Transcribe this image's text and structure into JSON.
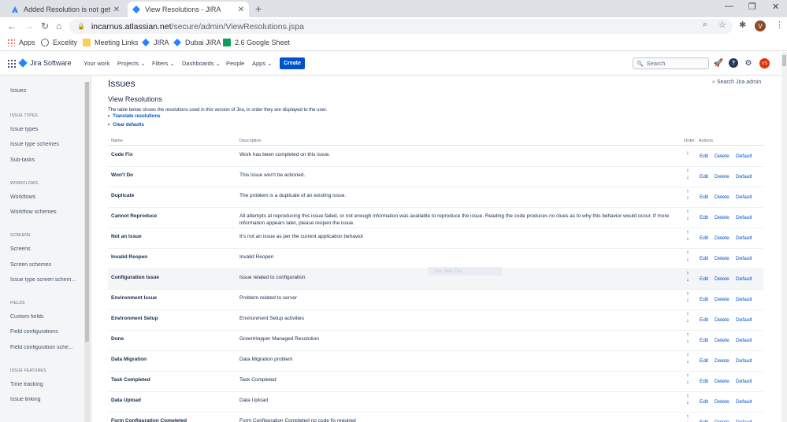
{
  "browser": {
    "tabs": [
      {
        "title": "Added Resolution is not getting",
        "active": false
      },
      {
        "title": "View Resolutions - JIRA",
        "active": true
      }
    ],
    "url_host": "incarnus.atlassian.net",
    "url_path": "/secure/admin/ViewResolutions.jspa",
    "profile_initial": "V",
    "bookmarks": [
      "Apps",
      "Excelity",
      "Meeting Links",
      "JIRA",
      "Dubai JIRA",
      "2.6 Google Sheet"
    ]
  },
  "nav": {
    "product": "Jira Software",
    "menu": [
      "Your work",
      "Projects",
      "Filters",
      "Dashboards",
      "People",
      "Apps"
    ],
    "create": "Create",
    "search_placeholder": "Search",
    "user_initials": "VS"
  },
  "sidebar": {
    "top": "Issues",
    "sections": [
      {
        "title": "ISSUE TYPES",
        "items": [
          "Issue types",
          "Issue type schemes",
          "Sub-tasks"
        ]
      },
      {
        "title": "WORKFLOWS",
        "items": [
          "Workflows",
          "Workflow schemes"
        ]
      },
      {
        "title": "SCREENS",
        "items": [
          "Screens",
          "Screen schemes",
          "Issue type screen schem..."
        ]
      },
      {
        "title": "FIELDS",
        "items": [
          "Custom fields",
          "Field configurations",
          "Field configuration sche..."
        ]
      },
      {
        "title": "ISSUE FEATURES",
        "items": [
          "Time tracking",
          "Issue linking"
        ]
      }
    ]
  },
  "main": {
    "title": "Issues",
    "search_admin": "Search Jira admin",
    "section_title": "View Resolutions",
    "intro": "The table below shows the resolutions used in this version of Jira, in order they are displayed to the user.",
    "links": [
      "Translate resolutions",
      "Clear defaults"
    ],
    "columns": {
      "name": "Name",
      "description": "Description",
      "order": "Order",
      "actions": "Actions"
    },
    "action_labels": {
      "edit": "Edit",
      "delete": "Delete",
      "default": "Default"
    },
    "ghost_text": "Jira Help Tips",
    "rows": [
      {
        "name": "Code Fix",
        "description": "Work has been completed on this issue.",
        "first": true
      },
      {
        "name": "Won't Do",
        "description": "This issue won't be actioned."
      },
      {
        "name": "Duplicate",
        "description": "The problem is a duplicate of an existing issue."
      },
      {
        "name": "Cannot Reproduce",
        "description": "All attempts at reproducing this issue failed, or not enough information was available to reproduce the issue. Reading the code produces no clues as to why this behavior would occur. If more information appears later, please reopen the issue."
      },
      {
        "name": "Not an Issue",
        "description": "It's not an issue as per the current application behavior"
      },
      {
        "name": "Invalid Reopen",
        "description": "Invalid Reopen"
      },
      {
        "name": "Configuration Issue",
        "description": "Issue related to configuration",
        "highlight": true
      },
      {
        "name": "Environment Issue",
        "description": "Problem related to server"
      },
      {
        "name": "Environment Setup",
        "description": "Environment Setup activities"
      },
      {
        "name": "Done",
        "description": "GreenHopper Managed Resolution"
      },
      {
        "name": "Data Migration",
        "description": "Data Migration problem"
      },
      {
        "name": "Task Completed",
        "description": "Task Completed"
      },
      {
        "name": "Data Upload",
        "description": "Data Upload"
      },
      {
        "name": "Form Configuration Completed",
        "description": "Form Configuration Completed no code fix required"
      }
    ]
  }
}
